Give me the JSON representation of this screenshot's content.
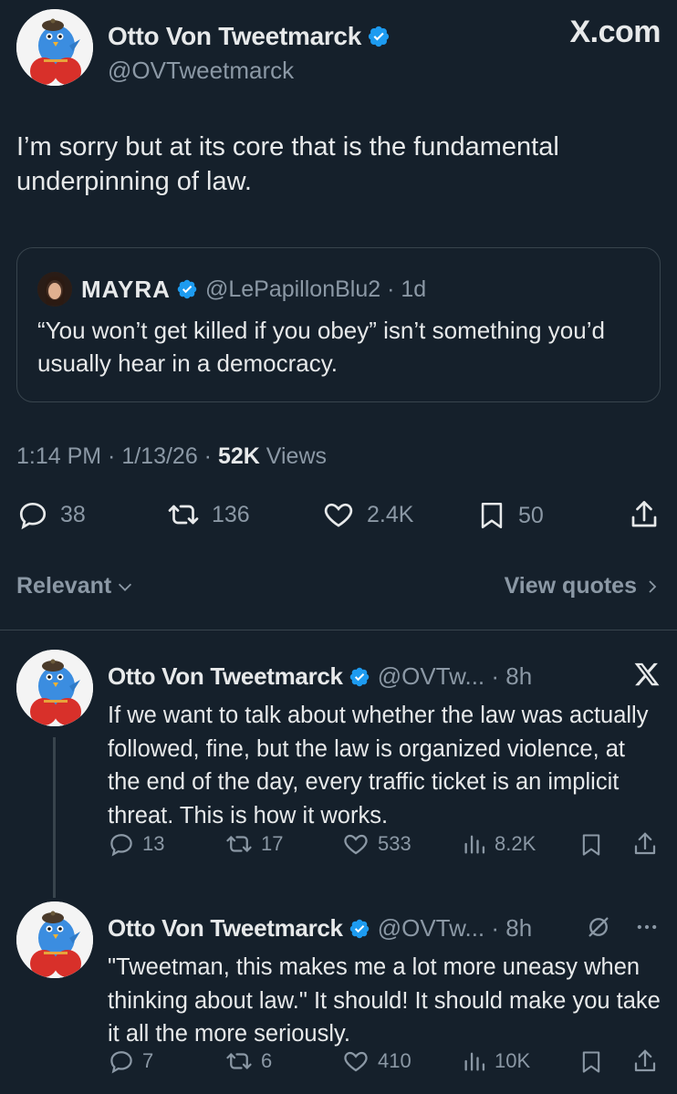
{
  "site_label": "X.com",
  "main_tweet": {
    "author_name": "Otto Von Tweetmarck",
    "author_handle": "@OVTweetmarck",
    "text": "I’m sorry but at its core that is the fundamental underpinning of law.",
    "quote": {
      "author_name": "MAYRA",
      "author_handle": "@LePapillonBlu2 · 1d",
      "text": "“You won’t get killed if you obey” isn’t something you’d usually hear in a democracy."
    },
    "time": "1:14 PM · 1/13/26 · ",
    "views_count": "52K",
    "views_label": " Views",
    "stats": {
      "replies": "38",
      "reposts": "136",
      "likes": "2.4K",
      "bookmarks": "50"
    }
  },
  "filters": {
    "sort_label": "Relevant",
    "view_quotes_label": "View quotes"
  },
  "replies": [
    {
      "author_name": "Otto Von Tweetmarck",
      "author_handle": "@OVTw... · 8h",
      "text": "If we want to talk about whether the law was actually followed, fine, but the law is organized violence, at the end of the day, every traffic ticket is an implicit threat. This is how it works.",
      "replies": "13",
      "reposts": "17",
      "likes": "533",
      "views": "8.2K"
    },
    {
      "author_name": "Otto Von Tweetmarck",
      "author_handle": "@OVTw... · 8h",
      "text": "\"Tweetman, this makes me a lot more uneasy when thinking about law.\" It should! It should make you take it all the more seriously.",
      "replies": "7",
      "reposts": "6",
      "likes": "410",
      "views": "10K"
    }
  ],
  "colors": {
    "background": "#15202b",
    "text": "#e7e9ea",
    "muted": "#8b98a5",
    "verified": "#1d9bf0",
    "border": "#38444d"
  },
  "icons": [
    "bird-avatar-icon",
    "verified-badge-icon",
    "reply-icon",
    "repost-icon",
    "like-icon",
    "bookmark-icon",
    "share-icon",
    "views-icon",
    "x-logo-icon",
    "grok-icon",
    "more-icon",
    "chevron-down-icon",
    "chevron-right-icon"
  ]
}
